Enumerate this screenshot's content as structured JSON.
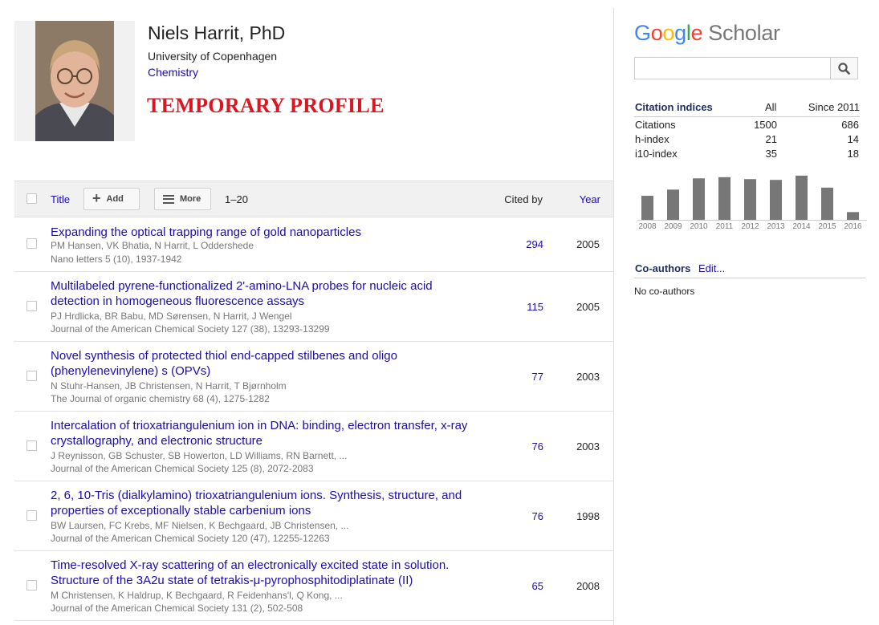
{
  "profile": {
    "name": "Niels Harrit",
    "degree": ", PhD",
    "affiliation": "University of Copenhagen",
    "field": "Chemistry",
    "temporary_label": "TEMPORARY PROFILE"
  },
  "table": {
    "title_header": "Title",
    "add_label": "Add",
    "more_label": "More",
    "range": "1–20",
    "cited_header": "Cited by",
    "year_header": "Year"
  },
  "articles": [
    {
      "title": "Expanding the optical trapping range of gold nanoparticles",
      "authors": "PM Hansen, VK Bhatia, N Harrit, L Oddershede",
      "venue": "Nano letters 5 (10), 1937-1942",
      "cited": "294",
      "year": "2005"
    },
    {
      "title": "Multilabeled pyrene-functionalized 2'-amino-LNA probes for nucleic acid detection in homogeneous fluorescence assays",
      "authors": "PJ Hrdlicka, BR Babu, MD Sørensen, N Harrit, J Wengel",
      "venue": "Journal of the American Chemical Society 127 (38), 13293-13299",
      "cited": "115",
      "year": "2005"
    },
    {
      "title": "Novel synthesis of protected thiol end-capped stilbenes and oligo (phenylenevinylene) s (OPVs)",
      "authors": "N Stuhr-Hansen, JB Christensen, N Harrit, T Bjørnholm",
      "venue": "The Journal of organic chemistry 68 (4), 1275-1282",
      "cited": "77",
      "year": "2003"
    },
    {
      "title": "Intercalation of trioxatriangulenium ion in DNA: binding, electron transfer, x-ray crystallography, and electronic structure",
      "authors": "J Reynisson, GB Schuster, SB Howerton, LD Williams, RN Barnett, ...",
      "venue": "Journal of the American Chemical Society 125 (8), 2072-2083",
      "cited": "76",
      "year": "2003"
    },
    {
      "title": "2, 6, 10-Tris (dialkylamino) trioxatriangulenium ions. Synthesis, structure, and properties of exceptionally stable carbenium ions",
      "authors": "BW Laursen, FC Krebs, MF Nielsen, K Bechgaard, JB Christensen, ...",
      "venue": "Journal of the American Chemical Society 120 (47), 12255-12263",
      "cited": "76",
      "year": "1998"
    },
    {
      "title": "Time-resolved X-ray scattering of an electronically excited state in solution. Structure of the 3A2u state of tetrakis-μ-pyrophosphitodiplatinate (II)",
      "authors": "M Christensen, K Haldrup, K Bechgaard, R Feidenhans'l, Q Kong, ...",
      "venue": "Journal of the American Chemical Society 131 (2), 502-508",
      "cited": "65",
      "year": "2008"
    }
  ],
  "sidebar": {
    "logo": {
      "g": "G",
      "o1": "o",
      "o2": "o",
      "g2": "g",
      "l": "l",
      "e": "e",
      "scholar": "Scholar"
    },
    "search_icon": "search-icon",
    "citation_indices": {
      "title": "Citation indices",
      "col_all": "All",
      "col_since": "Since 2011",
      "rows": [
        {
          "label": "Citations",
          "all": "1500",
          "since": "686"
        },
        {
          "label": "h-index",
          "all": "21",
          "since": "14"
        },
        {
          "label": "i10-index",
          "all": "35",
          "since": "18"
        }
      ]
    },
    "coauthors": {
      "title": "Co-authors",
      "edit": "Edit...",
      "empty": "No co-authors"
    }
  },
  "chart_data": {
    "type": "bar",
    "categories": [
      "2008",
      "2009",
      "2010",
      "2011",
      "2012",
      "2013",
      "2014",
      "2015",
      "2016"
    ],
    "values": [
      62,
      78,
      107,
      110,
      105,
      103,
      114,
      83,
      20
    ],
    "title": "",
    "xlabel": "",
    "ylabel": "",
    "ylim": [
      0,
      120
    ],
    "color": "#777777"
  }
}
